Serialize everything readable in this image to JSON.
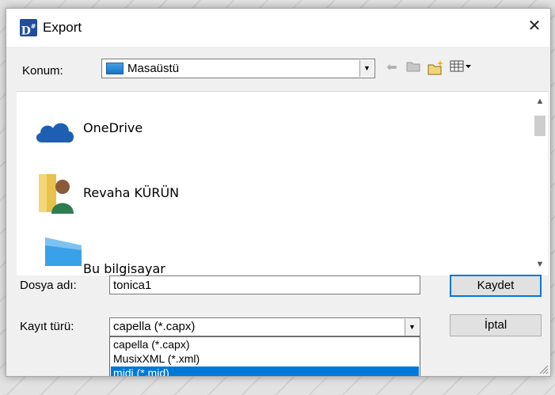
{
  "window": {
    "title": "Export",
    "app_icon": "D"
  },
  "location": {
    "label": "Konum:",
    "value": "Masaüstü"
  },
  "toolbar": {
    "icons": [
      "back-arrow-icon",
      "up-folder-icon",
      "new-folder-icon",
      "view-menu-icon"
    ]
  },
  "file_list": {
    "items": [
      {
        "label": "OneDrive",
        "icon": "onedrive-icon"
      },
      {
        "label": "Revaha KÜRÜN",
        "icon": "user-folder-icon"
      },
      {
        "label": "Bu bilgisayar",
        "icon": "computer-icon"
      }
    ]
  },
  "filename": {
    "label": "Dosya adı:",
    "value": "tonica1"
  },
  "filetype": {
    "label": "Kayıt türü:",
    "selected": "capella (*.capx)",
    "options": [
      "capella (*.capx)",
      "MusixXML (*.xml)",
      "midi (*.mid)"
    ],
    "highlighted_index": 2
  },
  "buttons": {
    "save": "Kaydet",
    "cancel": "İptal"
  },
  "colors": {
    "selection": "#0078d7",
    "app_icon": "#1f4e9c"
  }
}
